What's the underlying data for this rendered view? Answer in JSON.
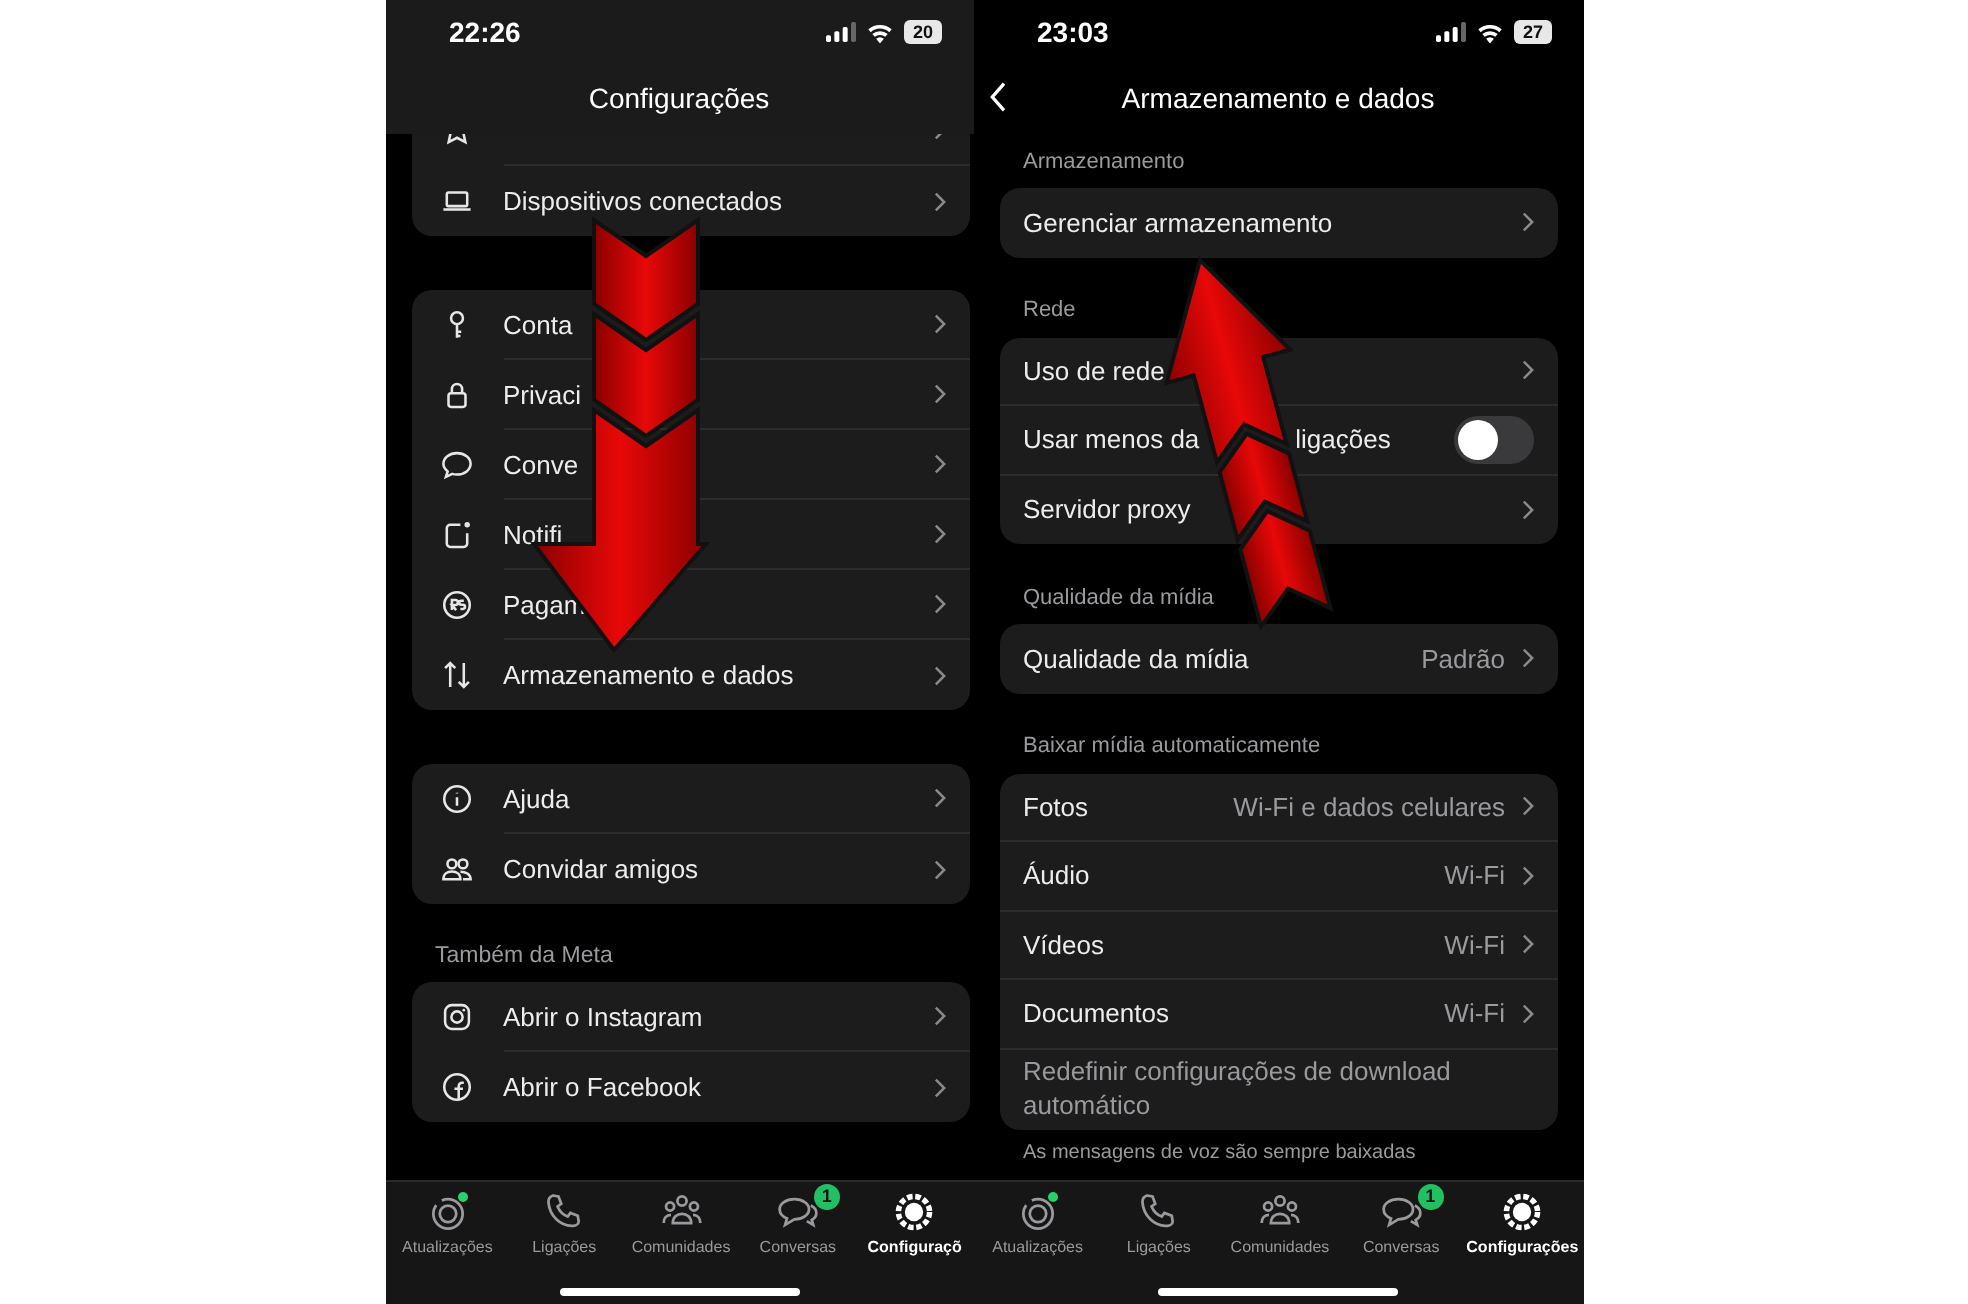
{
  "left_screen": {
    "status_bar": {
      "time": "22:26",
      "battery": "20"
    },
    "title": "Configurações",
    "groups": [
      {
        "rows": [
          {},
          {
            "label": "Dispositivos conectados"
          }
        ]
      },
      {
        "rows": [
          {
            "label": "Conta"
          },
          {
            "label": "Privaci"
          },
          {
            "label": "Conve"
          },
          {
            "label": "Notifi"
          },
          {
            "label": "Pagam"
          },
          {
            "label": "Armazenamento e dados"
          }
        ]
      },
      {
        "rows": [
          {
            "label": "Ajuda"
          },
          {
            "label": "Convidar amigos"
          }
        ]
      },
      {
        "header": "Também da Meta",
        "rows": [
          {
            "label": "Abrir o Instagram"
          },
          {
            "label": "Abrir o Facebook"
          }
        ]
      }
    ],
    "tab_bar": [
      {
        "label": "Atualizações",
        "selected": false,
        "unread_dot": true
      },
      {
        "label": "Ligações",
        "selected": false,
        "unread_dot": false
      },
      {
        "label": "Comunidades",
        "selected": false,
        "unread_dot": false
      },
      {
        "label": "Conversas",
        "selected": false,
        "unread_dot": false,
        "badge": "1"
      },
      {
        "label": "Configuraçõ",
        "selected": true,
        "unread_dot": false
      }
    ]
  },
  "right_screen": {
    "status_bar": {
      "time": "23:03",
      "battery": "27"
    },
    "title": "Armazenamento e dados",
    "sections": [
      {
        "header": "Armazenamento",
        "rows": [
          {
            "kind": "link",
            "label": "Gerenciar armazenamento"
          }
        ]
      },
      {
        "header": "Rede",
        "rows": [
          {
            "kind": "link",
            "label": "Uso de rede"
          },
          {
            "kind": "toggle",
            "label": "Usar menos da",
            "label_end": "ligações",
            "on": false
          },
          {
            "kind": "link",
            "label": "Servidor proxy"
          }
        ]
      },
      {
        "header": "Qualidade da mídia",
        "rows": [
          {
            "kind": "link",
            "label": "Qualidade da mídia",
            "value": "Padrão"
          }
        ]
      },
      {
        "header": "Baixar mídia automaticamente",
        "rows": [
          {
            "kind": "link",
            "label": "Fotos",
            "value": "Wi-Fi e dados celulares"
          },
          {
            "kind": "link",
            "label": "Áudio",
            "value": "Wi-Fi"
          },
          {
            "kind": "link",
            "label": "Vídeos",
            "value": "Wi-Fi"
          },
          {
            "kind": "link",
            "label": "Documentos",
            "value": "Wi-Fi"
          },
          {
            "kind": "text",
            "label": "Redefinir configurações de download automático"
          }
        ],
        "footer": "As mensagens de voz são sempre baixadas"
      }
    ],
    "tab_bar": [
      {
        "label": "Atualizações",
        "selected": false,
        "unread_dot": true
      },
      {
        "label": "Ligações",
        "selected": false,
        "unread_dot": false
      },
      {
        "label": "Comunidades",
        "selected": false,
        "unread_dot": false
      },
      {
        "label": "Conversas",
        "selected": false,
        "unread_dot": false,
        "badge": "1"
      },
      {
        "label": "Configurações",
        "selected": true,
        "unread_dot": false
      }
    ]
  }
}
